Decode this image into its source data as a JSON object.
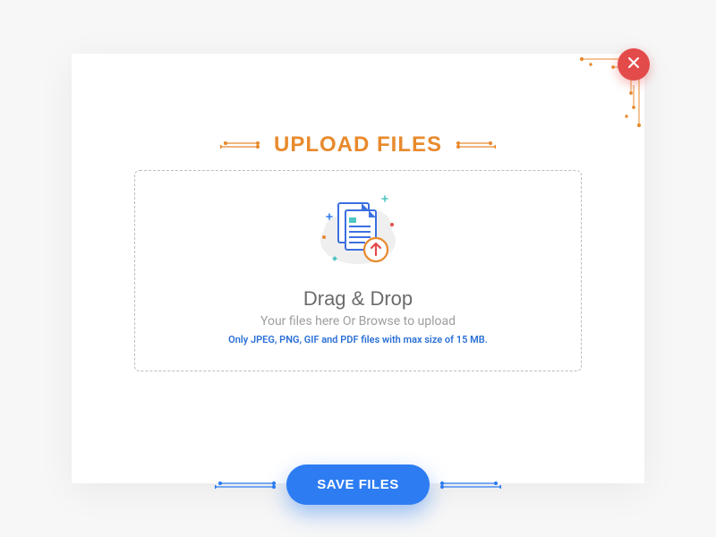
{
  "header": {
    "title": "UPLOAD FILES"
  },
  "dropzone": {
    "title": "Drag & Drop",
    "subtitle": "Your files here Or Browse to upload",
    "hint": "Only JPEG, PNG, GIF and PDF files with max size of 15 MB."
  },
  "actions": {
    "save_label": "SAVE FILES"
  },
  "colors": {
    "accent_orange": "#e88a2d",
    "accent_blue": "#2d7cf2",
    "close_red": "#e34b4b"
  }
}
